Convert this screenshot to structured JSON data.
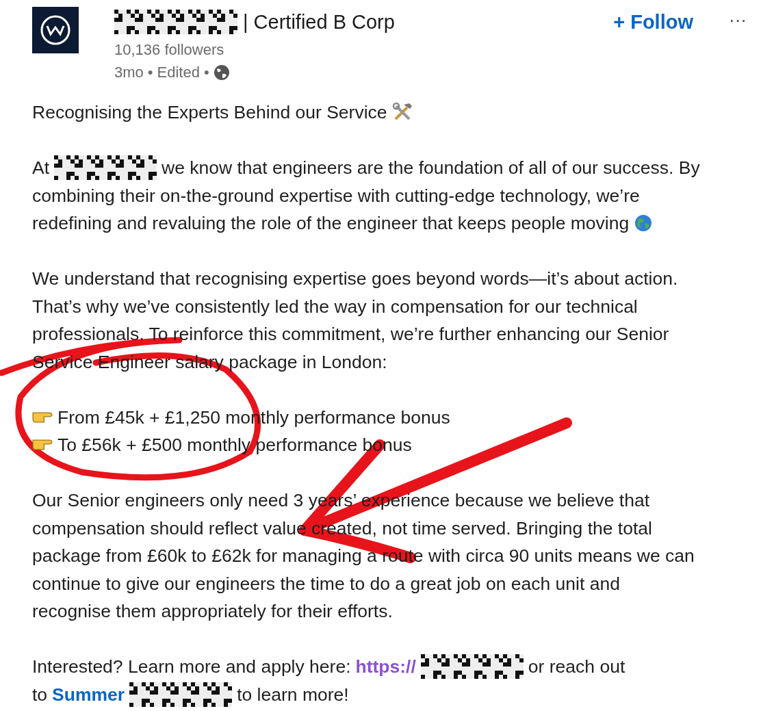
{
  "post": {
    "author_suffix": "| Certified B Corp",
    "followers": "10,136 followers",
    "age": "3mo",
    "edited": "Edited",
    "separator": "•",
    "follow_label": "+ Follow",
    "more_label": "···"
  },
  "paragraphs": [
    {
      "lines": [
        [
          {
            "kind": "text",
            "text": "Recognising the Experts Behind our Service"
          },
          {
            "kind": "tools"
          }
        ]
      ]
    },
    {
      "lines": [
        [
          {
            "kind": "text",
            "text": "At"
          },
          {
            "kind": "redacted"
          },
          {
            "kind": "text",
            "text": "we know that engineers are the foundation of all of our success. By"
          }
        ],
        [
          {
            "kind": "text",
            "text": "combining their on-the-ground expertise with cutting-edge technology, we’re"
          }
        ],
        [
          {
            "kind": "text",
            "text": "redefining and revaluing the role of the engineer that keeps people moving"
          },
          {
            "kind": "globe"
          }
        ]
      ]
    },
    {
      "lines": [
        [
          {
            "kind": "text",
            "text": "We understand that recognising expertise goes beyond words—it’s about action."
          }
        ],
        [
          {
            "kind": "text",
            "text": "That’s why we’ve consistently led the way in compensation for our technical"
          }
        ],
        [
          {
            "kind": "text",
            "text": "professionals. To reinforce this commitment, we’re further enhancing our Senior"
          }
        ],
        [
          {
            "kind": "text",
            "text": "Service Engineer salary package in London:"
          }
        ]
      ]
    },
    {
      "lines": [
        [
          {
            "kind": "bullet"
          },
          {
            "kind": "text",
            "text": "From £45k + £1,250 monthly performance bonus"
          }
        ],
        [
          {
            "kind": "bullet"
          },
          {
            "kind": "text",
            "text": "To £56k + £500 monthly performance bonus"
          }
        ]
      ]
    },
    {
      "lines": [
        [
          {
            "kind": "text",
            "text": "Our Senior engineers only need 3 years’ experience because we believe that"
          }
        ],
        [
          {
            "kind": "text",
            "text": "compensation should reflect value created, not time served. Bringing the total"
          }
        ],
        [
          {
            "kind": "text",
            "text": "package from £60k to £62k for managing a route with circa 90 units means we can"
          }
        ],
        [
          {
            "kind": "text",
            "text": "continue to give our engineers the time to do a great job on each unit and"
          }
        ],
        [
          {
            "kind": "text",
            "text": "recognise them appropriately for their efforts."
          }
        ]
      ]
    },
    {
      "lines": [
        [
          {
            "kind": "text",
            "text": "Interested? Learn more and apply here:"
          },
          {
            "kind": "url",
            "text": "https://"
          },
          {
            "kind": "redacted"
          },
          {
            "kind": "text",
            "text": "or reach out"
          }
        ],
        [
          {
            "kind": "text",
            "text": "to"
          },
          {
            "kind": "mention",
            "text": "Summer"
          },
          {
            "kind": "redacted"
          },
          {
            "kind": "text",
            "text": "to learn more!"
          }
        ]
      ]
    }
  ]
}
